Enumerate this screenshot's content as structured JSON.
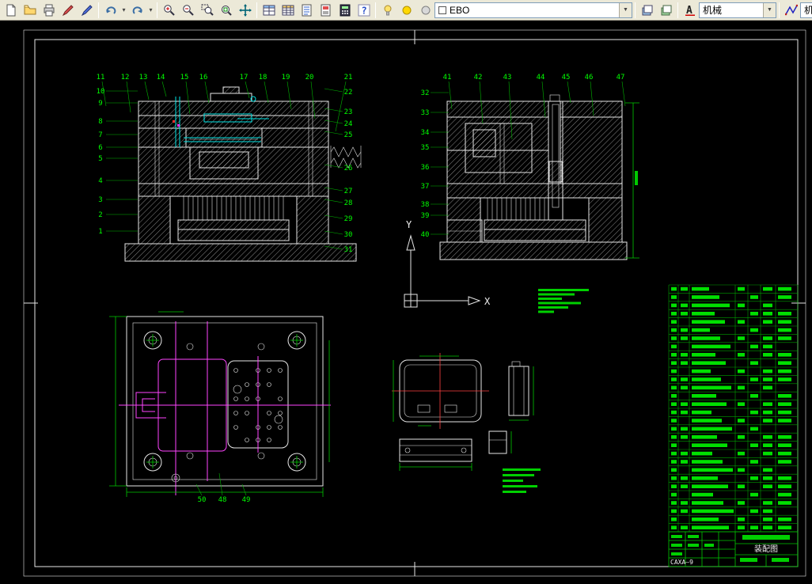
{
  "app": {
    "toolbar_bg": "#ece9d8",
    "canvas_bg": "#000000",
    "line_color": "#e6e6e6",
    "annotation_color": "#00ff00",
    "center_line_color": "#ff45ff"
  },
  "toolbar": {
    "file_icons": [
      "new-page-icon",
      "open-folder-icon",
      "printer-icon",
      "pen-red-icon",
      "pen-blue-icon"
    ],
    "edit_icons": [
      "undo-icon",
      "redo-icon"
    ],
    "zoom_icons": [
      "zoom-in-icon",
      "zoom-out-icon",
      "zoom-window-icon",
      "zoom-extents-icon",
      "pan-icon"
    ],
    "tool_icons": [
      "layer-table-icon",
      "grid-table-icon",
      "sheet-list-icon",
      "red-sheet-icon",
      "calculator-icon",
      "help-icon"
    ],
    "display_icons": [
      "bulb-icon",
      "sun-icon",
      "orb-icon"
    ],
    "sheet_icons": [
      "layers-blue-icon",
      "layers-green-icon"
    ],
    "style_icons": [
      "text-style-icon"
    ],
    "draw_icons": [
      "polyline-icon"
    ],
    "linetype_combo_value": "EBO",
    "standard_combo_value": "机械",
    "clipped_combo_value": "机"
  },
  "drawing": {
    "axes": {
      "x": "X",
      "y": "Y"
    },
    "callouts": {
      "front_section": {
        "top": [
          "11",
          "12",
          "13",
          "14",
          "15",
          "16",
          "17",
          "18",
          "19",
          "20"
        ],
        "top_right": "21",
        "left": [
          "10",
          "9",
          "8",
          "7",
          "6",
          "5",
          "4",
          "3",
          "2",
          "1"
        ],
        "right": [
          "22",
          "23",
          "24",
          "25",
          "26",
          "27",
          "28",
          "29",
          "30",
          "31"
        ]
      },
      "side_section": {
        "top": [
          "41",
          "42",
          "43",
          "44",
          "45",
          "46",
          "47"
        ],
        "left": [
          "32",
          "33",
          "34",
          "35",
          "36",
          "37",
          "38",
          "39",
          "40"
        ]
      },
      "plan_view": {
        "bottom": [
          "50",
          "48",
          "49"
        ]
      }
    },
    "notes": {
      "technical_note_line_count": 6,
      "remark_note_line_count": 5
    },
    "parts_table": {
      "row_count": 30,
      "column_count": 7
    },
    "title_block": {
      "drawing_code": "CAXA—9",
      "drawing_title": "装配图"
    }
  }
}
